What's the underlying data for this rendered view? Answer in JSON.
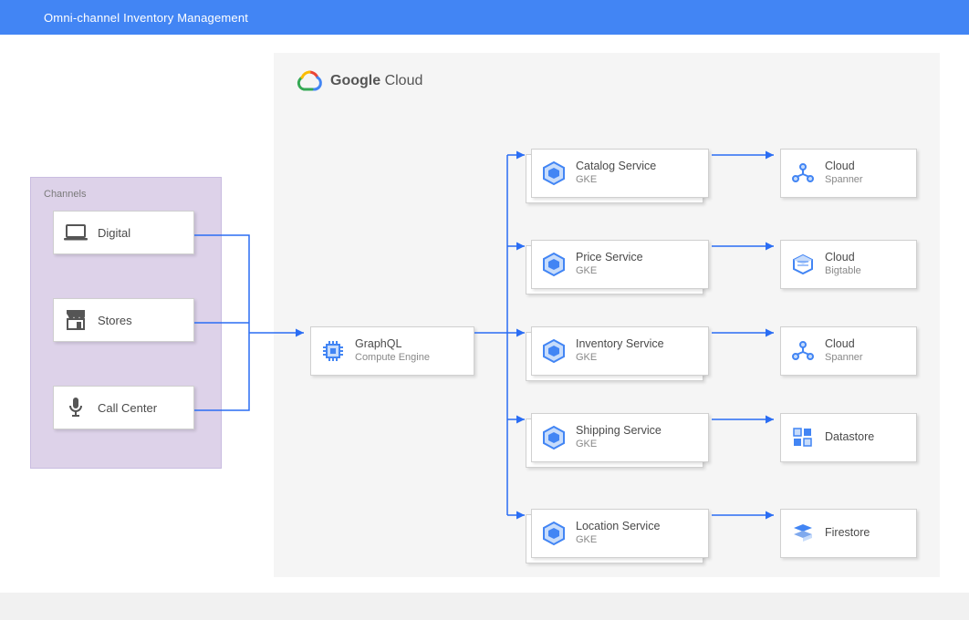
{
  "header": {
    "title": "Omni-channel Inventory Management"
  },
  "channels": {
    "label": "Channels",
    "items": [
      {
        "label": "Digital"
      },
      {
        "label": "Stores"
      },
      {
        "label": "Call Center"
      }
    ]
  },
  "cloud": {
    "brand_a": "Google",
    "brand_b": "Cloud",
    "compute": {
      "title": "GraphQL",
      "subtitle": "Compute Engine"
    },
    "services": [
      {
        "title": "Catalog Service",
        "subtitle": "GKE"
      },
      {
        "title": "Price Service",
        "subtitle": "GKE"
      },
      {
        "title": "Inventory Service",
        "subtitle": "GKE"
      },
      {
        "title": "Shipping Service",
        "subtitle": "GKE"
      },
      {
        "title": "Location Service",
        "subtitle": "GKE"
      }
    ],
    "datastores": [
      {
        "title": "Cloud",
        "subtitle": "Spanner"
      },
      {
        "title": "Cloud",
        "subtitle": "Bigtable"
      },
      {
        "title": "Cloud",
        "subtitle": "Spanner"
      },
      {
        "title": "Datastore",
        "subtitle": ""
      },
      {
        "title": "Firestore",
        "subtitle": ""
      }
    ]
  }
}
